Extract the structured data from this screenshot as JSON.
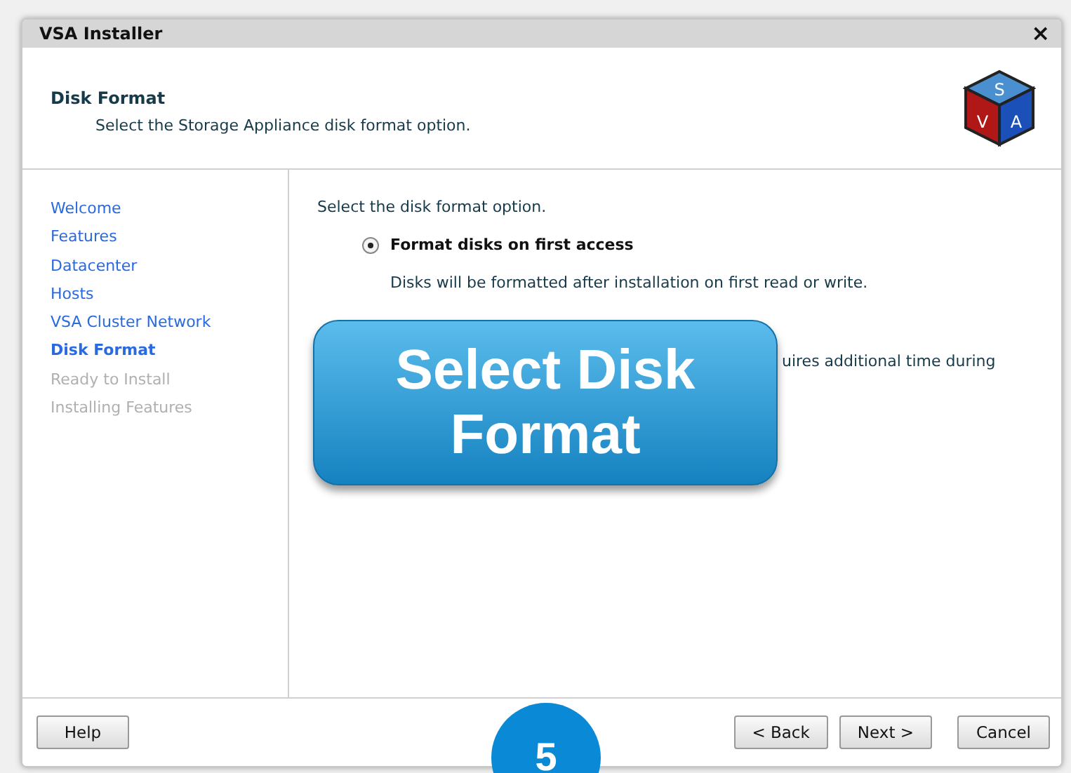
{
  "window": {
    "title": "VSA Installer",
    "close": "×"
  },
  "header": {
    "title": "Disk Format",
    "subtitle": "Select the Storage Appliance disk format option.",
    "logo_letters": [
      "S",
      "V",
      "A"
    ]
  },
  "sidebar": {
    "items": [
      {
        "label": "Welcome",
        "disabled": false,
        "selected": false
      },
      {
        "label": "Features",
        "disabled": false,
        "selected": false
      },
      {
        "label": "Datacenter",
        "disabled": false,
        "selected": false
      },
      {
        "label": "Hosts",
        "disabled": false,
        "selected": false
      },
      {
        "label": "VSA Cluster Network",
        "disabled": false,
        "selected": false
      },
      {
        "label": "Disk Format",
        "disabled": false,
        "selected": true
      },
      {
        "label": "Ready to Install",
        "disabled": true,
        "selected": false
      },
      {
        "label": "Installing Features",
        "disabled": true,
        "selected": false
      }
    ]
  },
  "content": {
    "prompt": "Select the disk format option.",
    "option": {
      "label": "Format disks on first access",
      "selected": true,
      "description": "Disks will be formatted after installation on first read or write."
    },
    "partial_text": "uires additional time during"
  },
  "callout": {
    "text": "Select Disk Format"
  },
  "step_badge": "5",
  "buttons": {
    "left": [
      "Help"
    ],
    "right": [
      "< Back",
      "Next >",
      "Cancel"
    ]
  }
}
